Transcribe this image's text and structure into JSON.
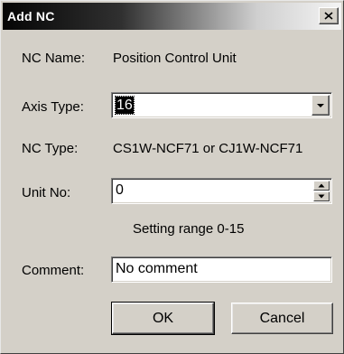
{
  "window": {
    "title": "Add NC",
    "close_icon": "close-icon",
    "colors": {
      "face": "#d4d0c8",
      "title_dark": "#050505",
      "title_light": "#f4f4f4"
    }
  },
  "fields": {
    "nc_name": {
      "label": "NC Name:",
      "value": "Position Control Unit"
    },
    "axis_type": {
      "label": "Axis Type:",
      "value": "16",
      "dropdown_icon": "chevron-down-icon"
    },
    "nc_type": {
      "label": "NC Type:",
      "value": "CS1W-NCF71 or CJ1W-NCF71"
    },
    "unit_no": {
      "label": "Unit No:",
      "value": "0",
      "range_hint": "Setting range 0-15"
    },
    "comment": {
      "label": "Comment:",
      "value": "No comment"
    }
  },
  "buttons": {
    "ok": "OK",
    "cancel": "Cancel"
  }
}
